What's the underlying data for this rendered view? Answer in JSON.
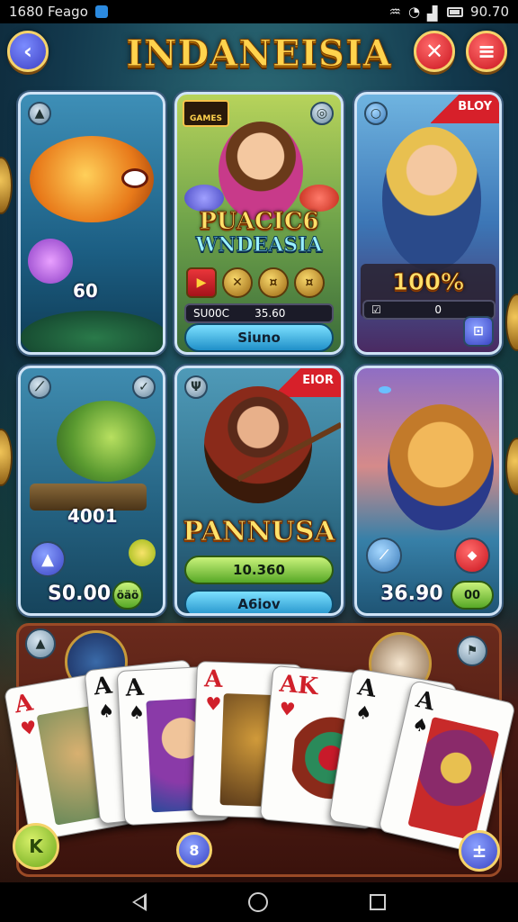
{
  "statusbar": {
    "time": "1680 Feago",
    "battery": "90.70"
  },
  "header": {
    "title": "INDANEISIA",
    "back_icon": "‹",
    "close_icon": "✕",
    "menu_icon": "≡"
  },
  "cards": [
    {
      "id": "fish",
      "value": "60",
      "corner": "▲"
    },
    {
      "id": "princess",
      "tag": "GAMES",
      "title_line1": "PUACIC6",
      "title_line2": "WNDEASIA",
      "bar_left": "SU00C",
      "bar_value": "35.60",
      "button": "Siuno"
    },
    {
      "id": "mermaid",
      "ribbon": "BLOY",
      "percent": "100%",
      "bar_value": "0"
    },
    {
      "id": "catfish",
      "value": "4001",
      "balance": "S0.00",
      "badge": "öäö"
    },
    {
      "id": "warrior",
      "ribbon": "EIOR",
      "title": "PANNUSA",
      "amount": "10.360",
      "button": "A6iov"
    },
    {
      "id": "creature",
      "balance": "36.90",
      "badge": "00"
    }
  ],
  "playing_cards": [
    {
      "rank": "A",
      "suit": "♥",
      "color": "red"
    },
    {
      "rank": "A",
      "suit": "♠",
      "color": "black"
    },
    {
      "rank": "A",
      "suit": "♠",
      "color": "black"
    },
    {
      "rank": "A",
      "suit": "♥",
      "color": "red"
    },
    {
      "rank": "AK",
      "suit": "♥",
      "color": "red"
    },
    {
      "rank": "A",
      "suit": "♠",
      "color": "black"
    },
    {
      "rank": "A",
      "suit": "♠",
      "color": "black"
    }
  ],
  "bottom": {
    "left_icon": "K",
    "center_icon": "8",
    "right_icon": "±"
  },
  "colors": {
    "gold": "#ffd34d",
    "red": "#d7202a",
    "blue": "#1f8fc8",
    "green": "#57a826"
  }
}
